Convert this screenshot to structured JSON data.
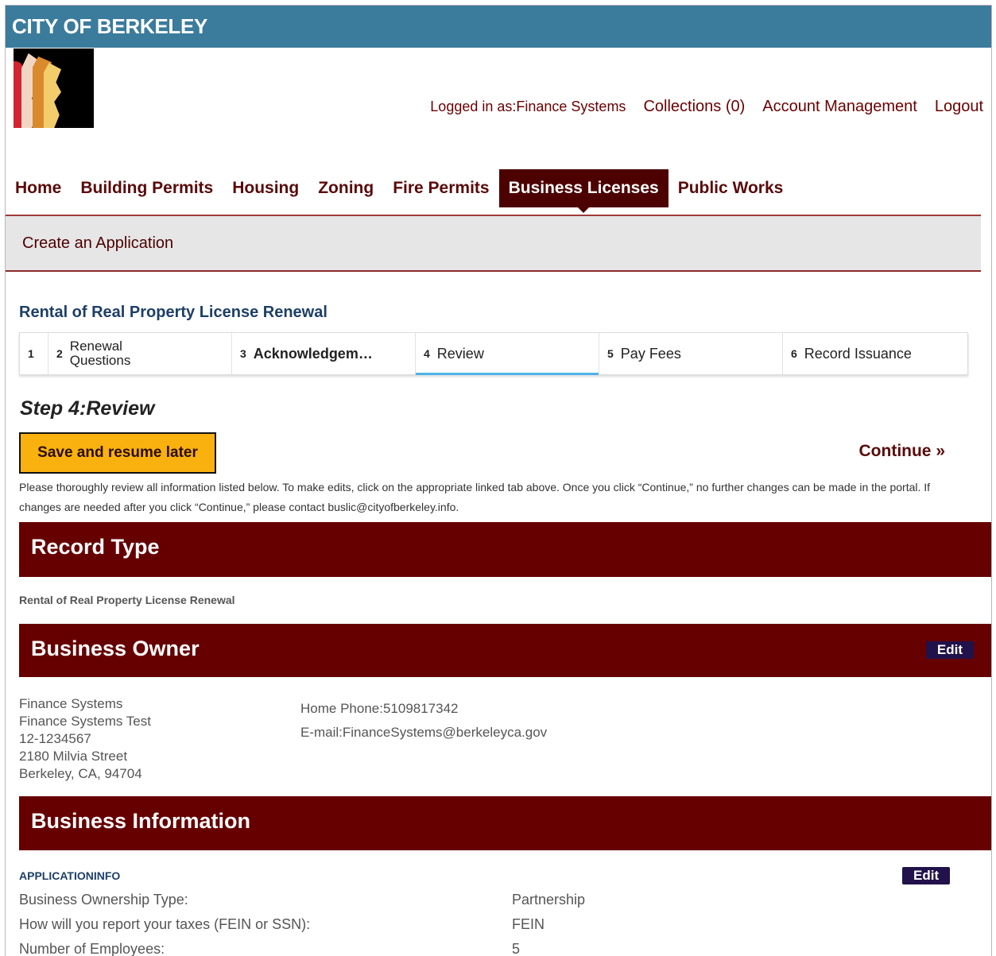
{
  "header": {
    "city": "CITY OF BERKELEY"
  },
  "user_links": {
    "logged_in": "Logged in as:Finance Systems",
    "collections": "Collections (0)",
    "account": "Account Management",
    "logout": "Logout"
  },
  "nav": {
    "items": [
      {
        "label": "Home",
        "active": false
      },
      {
        "label": "Building Permits",
        "active": false
      },
      {
        "label": "Housing",
        "active": false
      },
      {
        "label": "Zoning",
        "active": false
      },
      {
        "label": "Fire Permits",
        "active": false
      },
      {
        "label": "Business Licenses",
        "active": true
      },
      {
        "label": "Public Works",
        "active": false
      }
    ]
  },
  "subbar": {
    "title": "Create an Application"
  },
  "record_title": "Rental of Real Property License Renewal",
  "steps": [
    {
      "num": "1",
      "label": ""
    },
    {
      "num": "2",
      "label": "Renewal Questions"
    },
    {
      "num": "3",
      "label": "Acknowledgem…"
    },
    {
      "num": "4",
      "label": "Review",
      "active": true
    },
    {
      "num": "5",
      "label": "Pay Fees"
    },
    {
      "num": "6",
      "label": "Record Issuance"
    }
  ],
  "step_heading": "Step 4:Review",
  "buttons": {
    "save": "Save and resume later",
    "continue": "Continue »",
    "edit": "Edit"
  },
  "instructions": "Please thoroughly review all information listed below. To make edits, click on the appropriate linked tab above. Once you click “Continue,” no further changes can be made in the portal. If changes are needed after you click “Continue,” please contact buslic@cityofberkeley.info.",
  "record_type": {
    "heading": "Record Type",
    "value": "Rental of Real Property License Renewal"
  },
  "business_owner": {
    "heading": "Business Owner",
    "name": "Finance Systems",
    "business": "Finance Systems Test",
    "id": "12-1234567",
    "street": "2180 Milvia Street",
    "city_line": "Berkeley, CA, 94704",
    "phone": "Home Phone:5109817342",
    "email": "E-mail:FinanceSystems@berkeleyca.gov"
  },
  "business_info": {
    "heading": "Business Information",
    "group": "APPLICATIONINFO",
    "rows": [
      {
        "label": "Business Ownership Type:",
        "value": "Partnership"
      },
      {
        "label": "How will you report your taxes (FEIN or SSN):",
        "value": "FEIN"
      },
      {
        "label": "Number of Employees:",
        "value": "5"
      }
    ]
  },
  "colors": {
    "topbar": "#3b7b9c",
    "maroon": "#660000",
    "save_button": "#f9b10f",
    "edit_button": "#22124b",
    "active_step": "#4fb3e8"
  }
}
